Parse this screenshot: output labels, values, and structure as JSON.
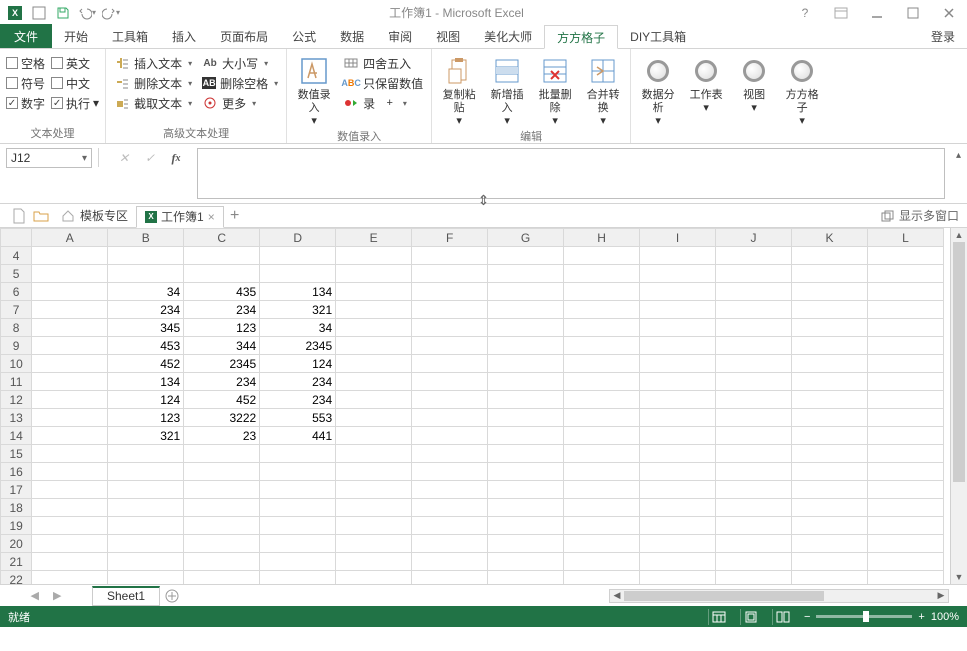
{
  "titlebar": {
    "title": "工作簿1 - Microsoft Excel"
  },
  "ribbon_tabs": {
    "file": "文件",
    "tabs": [
      "开始",
      "工具箱",
      "插入",
      "页面布局",
      "公式",
      "数据",
      "审阅",
      "视图",
      "美化大师",
      "方方格子",
      "DIY工具箱"
    ],
    "active": "方方格子",
    "login": "登录"
  },
  "ribbon": {
    "group1": {
      "label": "文本处理",
      "chk_space": "空格",
      "chk_en": "英文",
      "chk_symbol": "符号",
      "chk_cn": "中文",
      "chk_num": "数字",
      "chk_exec": "执行"
    },
    "group2": {
      "label": "高级文本处理",
      "insert_text": "插入文本",
      "case": "大小写",
      "delete_text": "删除文本",
      "delete_space": "删除空格",
      "extract_text": "截取文本",
      "more": "更多"
    },
    "group3": {
      "label": "数值录入",
      "num_input": "数值录入",
      "round": "四舍五入",
      "keep_num": "只保留数值",
      "rec": "录"
    },
    "group4": {
      "label": "编辑",
      "copy_paste": "复制粘贴",
      "add_insert": "新增插入",
      "batch_del": "批量删除",
      "merge_conv": "合并转换"
    },
    "group5": {
      "data_an": "数据分析",
      "worksheet": "工作表",
      "view": "视图",
      "ffgz": "方方格子"
    }
  },
  "namebox": "J12",
  "workbook_tabs": {
    "template": "模板专区",
    "book": "工作簿1",
    "multi": "显示多窗口"
  },
  "columns": [
    "A",
    "B",
    "C",
    "D",
    "E",
    "F",
    "G",
    "H",
    "I",
    "J",
    "K",
    "L"
  ],
  "rows_visible": [
    4,
    5,
    6,
    7,
    8,
    9,
    10,
    11,
    12,
    13,
    14,
    15,
    16,
    17,
    18,
    19,
    20,
    21,
    22
  ],
  "cells": {
    "6": {
      "B": "34",
      "C": "435",
      "D": "134"
    },
    "7": {
      "B": "234",
      "C": "234",
      "D": "321"
    },
    "8": {
      "B": "345",
      "C": "123",
      "D": "34"
    },
    "9": {
      "B": "453",
      "C": "344",
      "D": "2345"
    },
    "10": {
      "B": "452",
      "C": "2345",
      "D": "124"
    },
    "11": {
      "B": "134",
      "C": "234",
      "D": "234"
    },
    "12": {
      "B": "124",
      "C": "452",
      "D": "234"
    },
    "13": {
      "B": "123",
      "C": "3222",
      "D": "553"
    },
    "14": {
      "B": "321",
      "C": "23",
      "D": "441"
    }
  },
  "sheet_tab": "Sheet1",
  "status": {
    "ready": "就绪",
    "zoom": "100%"
  }
}
